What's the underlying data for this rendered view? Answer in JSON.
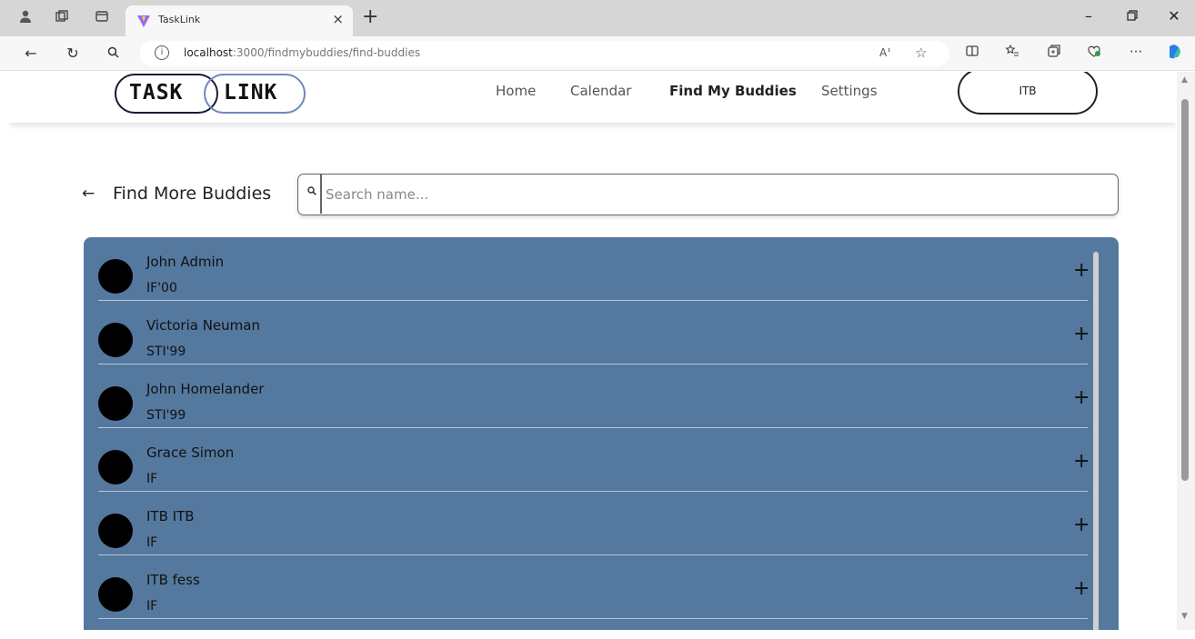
{
  "browser": {
    "tab_title": "TaskLink",
    "url_host": "localhost",
    "url_path": ":3000/findmybuddies/find-buddies"
  },
  "app": {
    "logo_left": "TASK",
    "logo_right": "LINK",
    "nav": [
      {
        "label": "Home",
        "active": false
      },
      {
        "label": "Calendar",
        "active": false
      },
      {
        "label": "Find My Buddies",
        "active": true
      },
      {
        "label": "Settings",
        "active": false
      }
    ],
    "org_button": "ITB"
  },
  "page": {
    "back_icon": "arrow-left-icon",
    "heading": "Find More Buddies",
    "search": {
      "placeholder": "Search name...",
      "value": ""
    }
  },
  "buddies": [
    {
      "name": "John Admin",
      "meta": "IF'00"
    },
    {
      "name": "Victoria Neuman",
      "meta": "STI'99"
    },
    {
      "name": "John Homelander",
      "meta": "STI'99"
    },
    {
      "name": "Grace Simon",
      "meta": "IF"
    },
    {
      "name": "ITB ITB",
      "meta": "IF"
    },
    {
      "name": "ITB fess",
      "meta": "IF"
    }
  ],
  "colors": {
    "list_bg": "#55789f",
    "logo_dark": "#1a1a3a",
    "logo_accent": "#6f86c0"
  }
}
